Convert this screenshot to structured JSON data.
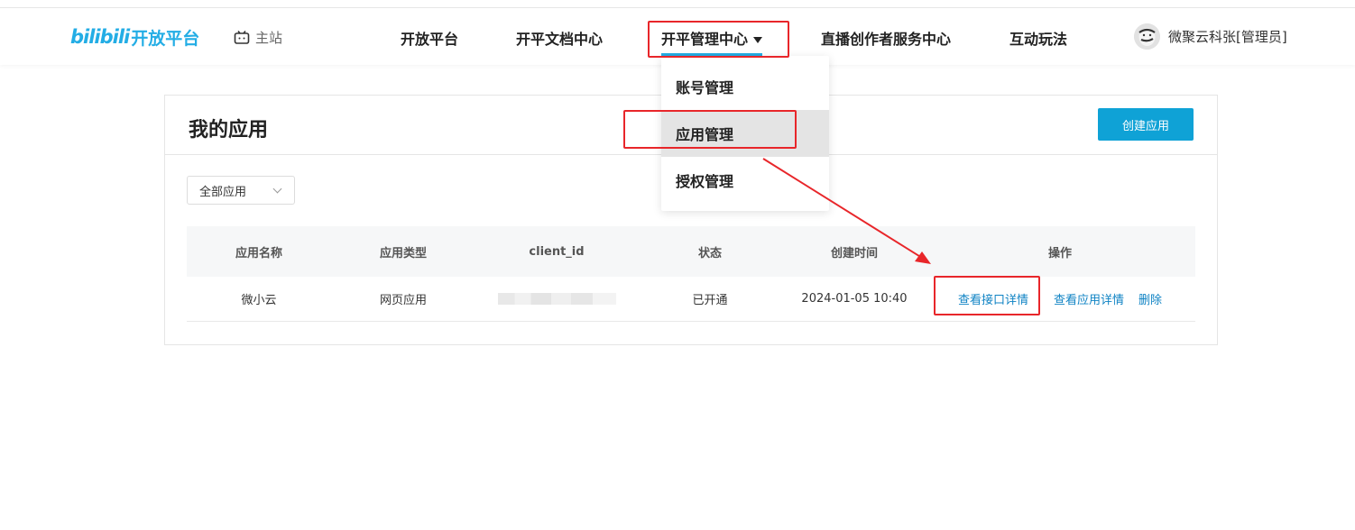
{
  "header": {
    "logo_bili": "bilibili",
    "logo_text": "开放平台",
    "main_site": "主站",
    "nav": {
      "open_platform": "开放平台",
      "docs_center": "开平文档中心",
      "management_center": "开平管理中心",
      "live_creator_center": "直播创作者服务中心",
      "interactive_play": "互动玩法"
    },
    "user_name": "微聚云科张[管理员]"
  },
  "dropdown": {
    "items": [
      "账号管理",
      "应用管理",
      "授权管理"
    ],
    "highlighted": "应用管理"
  },
  "panel": {
    "title": "我的应用",
    "create_button": "创建应用",
    "filter": {
      "selected": "全部应用"
    },
    "table": {
      "columns": [
        "应用名称",
        "应用类型",
        "client_id",
        "状态",
        "创建时间",
        "操作"
      ],
      "rows": [
        {
          "name": "微小云",
          "type": "网页应用",
          "client_id": "",
          "status": "已开通",
          "created": "2024-01-05 10:40",
          "actions": [
            "查看接口详情",
            "查看应用详情",
            "删除"
          ]
        }
      ]
    }
  },
  "colors": {
    "brand": "#23ade5",
    "primary_button": "#0fa2d6",
    "link": "#0f83c4",
    "annotation_red": "#e8262a"
  },
  "icons": {
    "main_site": "tv-icon",
    "nav_caret": "caret-down-icon",
    "select": "chevron-down-icon"
  }
}
